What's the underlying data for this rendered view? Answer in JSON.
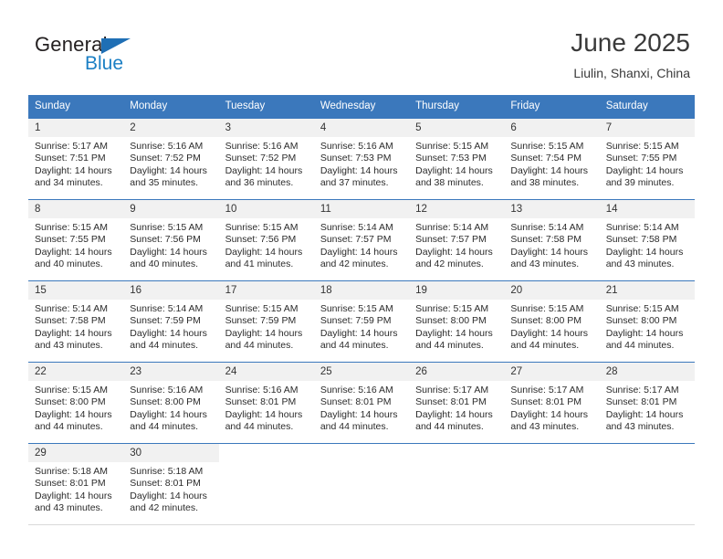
{
  "brand": {
    "name_top": "General",
    "name_bottom": "Blue",
    "triangle_color": "#1f6fb5",
    "blue_text_color": "#1b7fc4"
  },
  "header": {
    "title": "June 2025",
    "subtitle": "Liulin, Shanxi, China"
  },
  "theme": {
    "header_blue": "#3b78bc",
    "day_band_gray": "#f1f1f1",
    "text_color": "#2b2b2b"
  },
  "calendar": {
    "weekday_headers": [
      "Sunday",
      "Monday",
      "Tuesday",
      "Wednesday",
      "Thursday",
      "Friday",
      "Saturday"
    ],
    "weeks": [
      [
        {
          "day": "1",
          "sunrise": "Sunrise: 5:17 AM",
          "sunset": "Sunset: 7:51 PM",
          "daylight_line1": "Daylight: 14 hours",
          "daylight_line2": "and 34 minutes."
        },
        {
          "day": "2",
          "sunrise": "Sunrise: 5:16 AM",
          "sunset": "Sunset: 7:52 PM",
          "daylight_line1": "Daylight: 14 hours",
          "daylight_line2": "and 35 minutes."
        },
        {
          "day": "3",
          "sunrise": "Sunrise: 5:16 AM",
          "sunset": "Sunset: 7:52 PM",
          "daylight_line1": "Daylight: 14 hours",
          "daylight_line2": "and 36 minutes."
        },
        {
          "day": "4",
          "sunrise": "Sunrise: 5:16 AM",
          "sunset": "Sunset: 7:53 PM",
          "daylight_line1": "Daylight: 14 hours",
          "daylight_line2": "and 37 minutes."
        },
        {
          "day": "5",
          "sunrise": "Sunrise: 5:15 AM",
          "sunset": "Sunset: 7:53 PM",
          "daylight_line1": "Daylight: 14 hours",
          "daylight_line2": "and 38 minutes."
        },
        {
          "day": "6",
          "sunrise": "Sunrise: 5:15 AM",
          "sunset": "Sunset: 7:54 PM",
          "daylight_line1": "Daylight: 14 hours",
          "daylight_line2": "and 38 minutes."
        },
        {
          "day": "7",
          "sunrise": "Sunrise: 5:15 AM",
          "sunset": "Sunset: 7:55 PM",
          "daylight_line1": "Daylight: 14 hours",
          "daylight_line2": "and 39 minutes."
        }
      ],
      [
        {
          "day": "8",
          "sunrise": "Sunrise: 5:15 AM",
          "sunset": "Sunset: 7:55 PM",
          "daylight_line1": "Daylight: 14 hours",
          "daylight_line2": "and 40 minutes."
        },
        {
          "day": "9",
          "sunrise": "Sunrise: 5:15 AM",
          "sunset": "Sunset: 7:56 PM",
          "daylight_line1": "Daylight: 14 hours",
          "daylight_line2": "and 40 minutes."
        },
        {
          "day": "10",
          "sunrise": "Sunrise: 5:15 AM",
          "sunset": "Sunset: 7:56 PM",
          "daylight_line1": "Daylight: 14 hours",
          "daylight_line2": "and 41 minutes."
        },
        {
          "day": "11",
          "sunrise": "Sunrise: 5:14 AM",
          "sunset": "Sunset: 7:57 PM",
          "daylight_line1": "Daylight: 14 hours",
          "daylight_line2": "and 42 minutes."
        },
        {
          "day": "12",
          "sunrise": "Sunrise: 5:14 AM",
          "sunset": "Sunset: 7:57 PM",
          "daylight_line1": "Daylight: 14 hours",
          "daylight_line2": "and 42 minutes."
        },
        {
          "day": "13",
          "sunrise": "Sunrise: 5:14 AM",
          "sunset": "Sunset: 7:58 PM",
          "daylight_line1": "Daylight: 14 hours",
          "daylight_line2": "and 43 minutes."
        },
        {
          "day": "14",
          "sunrise": "Sunrise: 5:14 AM",
          "sunset": "Sunset: 7:58 PM",
          "daylight_line1": "Daylight: 14 hours",
          "daylight_line2": "and 43 minutes."
        }
      ],
      [
        {
          "day": "15",
          "sunrise": "Sunrise: 5:14 AM",
          "sunset": "Sunset: 7:58 PM",
          "daylight_line1": "Daylight: 14 hours",
          "daylight_line2": "and 43 minutes."
        },
        {
          "day": "16",
          "sunrise": "Sunrise: 5:14 AM",
          "sunset": "Sunset: 7:59 PM",
          "daylight_line1": "Daylight: 14 hours",
          "daylight_line2": "and 44 minutes."
        },
        {
          "day": "17",
          "sunrise": "Sunrise: 5:15 AM",
          "sunset": "Sunset: 7:59 PM",
          "daylight_line1": "Daylight: 14 hours",
          "daylight_line2": "and 44 minutes."
        },
        {
          "day": "18",
          "sunrise": "Sunrise: 5:15 AM",
          "sunset": "Sunset: 7:59 PM",
          "daylight_line1": "Daylight: 14 hours",
          "daylight_line2": "and 44 minutes."
        },
        {
          "day": "19",
          "sunrise": "Sunrise: 5:15 AM",
          "sunset": "Sunset: 8:00 PM",
          "daylight_line1": "Daylight: 14 hours",
          "daylight_line2": "and 44 minutes."
        },
        {
          "day": "20",
          "sunrise": "Sunrise: 5:15 AM",
          "sunset": "Sunset: 8:00 PM",
          "daylight_line1": "Daylight: 14 hours",
          "daylight_line2": "and 44 minutes."
        },
        {
          "day": "21",
          "sunrise": "Sunrise: 5:15 AM",
          "sunset": "Sunset: 8:00 PM",
          "daylight_line1": "Daylight: 14 hours",
          "daylight_line2": "and 44 minutes."
        }
      ],
      [
        {
          "day": "22",
          "sunrise": "Sunrise: 5:15 AM",
          "sunset": "Sunset: 8:00 PM",
          "daylight_line1": "Daylight: 14 hours",
          "daylight_line2": "and 44 minutes."
        },
        {
          "day": "23",
          "sunrise": "Sunrise: 5:16 AM",
          "sunset": "Sunset: 8:00 PM",
          "daylight_line1": "Daylight: 14 hours",
          "daylight_line2": "and 44 minutes."
        },
        {
          "day": "24",
          "sunrise": "Sunrise: 5:16 AM",
          "sunset": "Sunset: 8:01 PM",
          "daylight_line1": "Daylight: 14 hours",
          "daylight_line2": "and 44 minutes."
        },
        {
          "day": "25",
          "sunrise": "Sunrise: 5:16 AM",
          "sunset": "Sunset: 8:01 PM",
          "daylight_line1": "Daylight: 14 hours",
          "daylight_line2": "and 44 minutes."
        },
        {
          "day": "26",
          "sunrise": "Sunrise: 5:17 AM",
          "sunset": "Sunset: 8:01 PM",
          "daylight_line1": "Daylight: 14 hours",
          "daylight_line2": "and 44 minutes."
        },
        {
          "day": "27",
          "sunrise": "Sunrise: 5:17 AM",
          "sunset": "Sunset: 8:01 PM",
          "daylight_line1": "Daylight: 14 hours",
          "daylight_line2": "and 43 minutes."
        },
        {
          "day": "28",
          "sunrise": "Sunrise: 5:17 AM",
          "sunset": "Sunset: 8:01 PM",
          "daylight_line1": "Daylight: 14 hours",
          "daylight_line2": "and 43 minutes."
        }
      ],
      [
        {
          "day": "29",
          "sunrise": "Sunrise: 5:18 AM",
          "sunset": "Sunset: 8:01 PM",
          "daylight_line1": "Daylight: 14 hours",
          "daylight_line2": "and 43 minutes."
        },
        {
          "day": "30",
          "sunrise": "Sunrise: 5:18 AM",
          "sunset": "Sunset: 8:01 PM",
          "daylight_line1": "Daylight: 14 hours",
          "daylight_line2": "and 42 minutes."
        },
        {
          "day": "",
          "sunrise": "",
          "sunset": "",
          "daylight_line1": "",
          "daylight_line2": ""
        },
        {
          "day": "",
          "sunrise": "",
          "sunset": "",
          "daylight_line1": "",
          "daylight_line2": ""
        },
        {
          "day": "",
          "sunrise": "",
          "sunset": "",
          "daylight_line1": "",
          "daylight_line2": ""
        },
        {
          "day": "",
          "sunrise": "",
          "sunset": "",
          "daylight_line1": "",
          "daylight_line2": ""
        },
        {
          "day": "",
          "sunrise": "",
          "sunset": "",
          "daylight_line1": "",
          "daylight_line2": ""
        }
      ]
    ]
  }
}
